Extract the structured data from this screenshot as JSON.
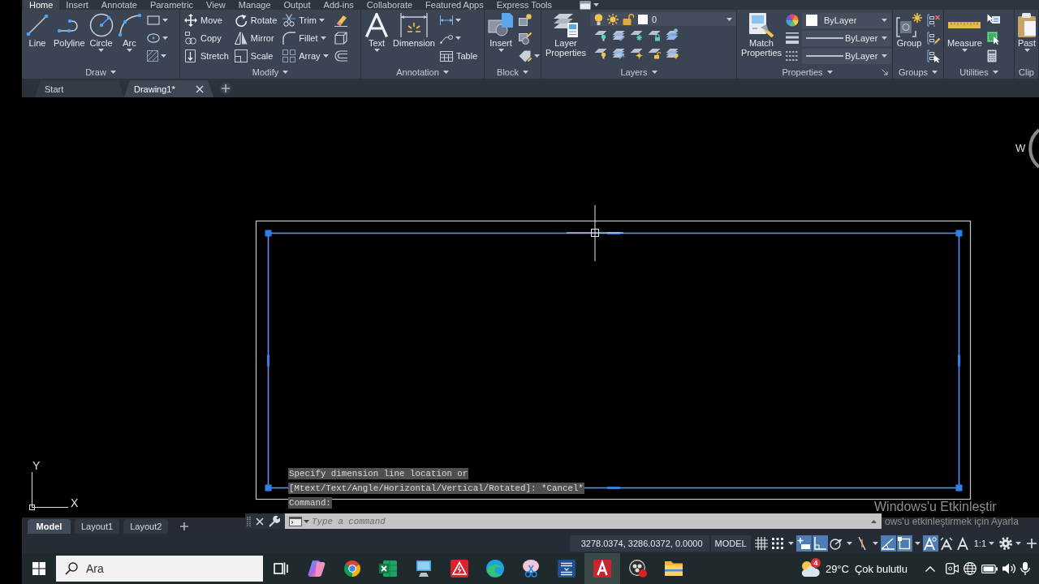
{
  "ribbon_tabs": [
    {
      "label": "Home",
      "selected": true
    },
    {
      "label": "Insert",
      "selected": false
    },
    {
      "label": "Annotate",
      "selected": false
    },
    {
      "label": "Parametric",
      "selected": false
    },
    {
      "label": "View",
      "selected": false
    },
    {
      "label": "Manage",
      "selected": false
    },
    {
      "label": "Output",
      "selected": false
    },
    {
      "label": "Add-ins",
      "selected": false
    },
    {
      "label": "Collaborate",
      "selected": false
    },
    {
      "label": "Featured Apps",
      "selected": false
    },
    {
      "label": "Express Tools",
      "selected": false
    }
  ],
  "ribbon_panels": [
    {
      "title": "Draw",
      "tools": [
        "Line",
        "Polyline",
        "Circle",
        "Arc"
      ]
    },
    {
      "title": "Modify",
      "tools": [
        "Move",
        "Copy",
        "Stretch",
        "Rotate",
        "Mirror",
        "Scale",
        "Trim",
        "Fillet",
        "Array"
      ]
    },
    {
      "title": "Annotation",
      "tools": [
        "Text",
        "Dimension",
        "Table"
      ]
    },
    {
      "title": "Block",
      "tools": [
        "Insert"
      ]
    },
    {
      "title": "Layers",
      "tools": [
        "Layer Properties"
      ],
      "layer": {
        "name": "0",
        "on": true,
        "frozen": false,
        "locked": false
      }
    },
    {
      "title": "Properties",
      "tools": [
        "Match Properties"
      ],
      "object_color": "ByLayer",
      "lineweight": "ByLayer",
      "linetype": "ByLayer"
    },
    {
      "title": "Groups",
      "tools": [
        "Group"
      ]
    },
    {
      "title": "Utilities",
      "tools": [
        "Measure"
      ]
    },
    {
      "title": "Clip",
      "tools": [
        "Past"
      ]
    }
  ],
  "file_tabs": [
    {
      "label": "Start",
      "selected": false,
      "closable": false
    },
    {
      "label": "Drawing1*",
      "selected": true,
      "closable": true
    }
  ],
  "canvas": {
    "objects": [
      {
        "selected": false
      },
      {
        "selected": true
      }
    ],
    "ucs": {
      "y_label": "Y",
      "x_label": "X"
    },
    "compass_label": "W"
  },
  "command_line": {
    "history": [
      "Specify dimension line location or",
      "[Mtext/Text/Angle/Horizontal/Vertical/Rotated]: *Cancel*",
      "Command:"
    ],
    "placeholder": "Type a command"
  },
  "activation_notice": {
    "title": "Windows'u Etkinleştir",
    "message": "ows'u etkinleştirmek için Ayarla"
  },
  "layout_tabs": [
    {
      "label": "Model",
      "selected": true
    },
    {
      "label": "Layout1",
      "selected": false
    },
    {
      "label": "Layout2",
      "selected": false
    }
  ],
  "status_bar": {
    "coordinates": "3278.0374, 3286.0372, 0.0000",
    "space": "MODEL",
    "toggles": [
      {
        "on": false
      },
      {
        "on": false
      },
      {
        "on": true
      },
      {
        "on": true
      },
      {
        "on": false
      },
      {
        "on": false
      },
      {
        "on": true
      },
      {
        "on": true
      },
      {
        "on": true
      },
      {
        "on": false
      },
      {
        "on": false
      }
    ],
    "annotation_scale": "1:1"
  },
  "taskbar": {
    "search": {
      "placeholder": "Ara"
    },
    "apps": [
      {
        "active": false
      },
      {
        "active": false
      },
      {
        "active": false
      },
      {
        "active": false
      },
      {
        "active": false
      },
      {
        "active": false
      },
      {
        "active": false
      },
      {
        "active": false
      },
      {
        "active": true
      },
      {
        "active": false
      },
      {
        "active": false
      }
    ],
    "weather": {
      "badge": "4",
      "temperature": "29°C",
      "condition": "Çok bulutlu"
    }
  }
}
